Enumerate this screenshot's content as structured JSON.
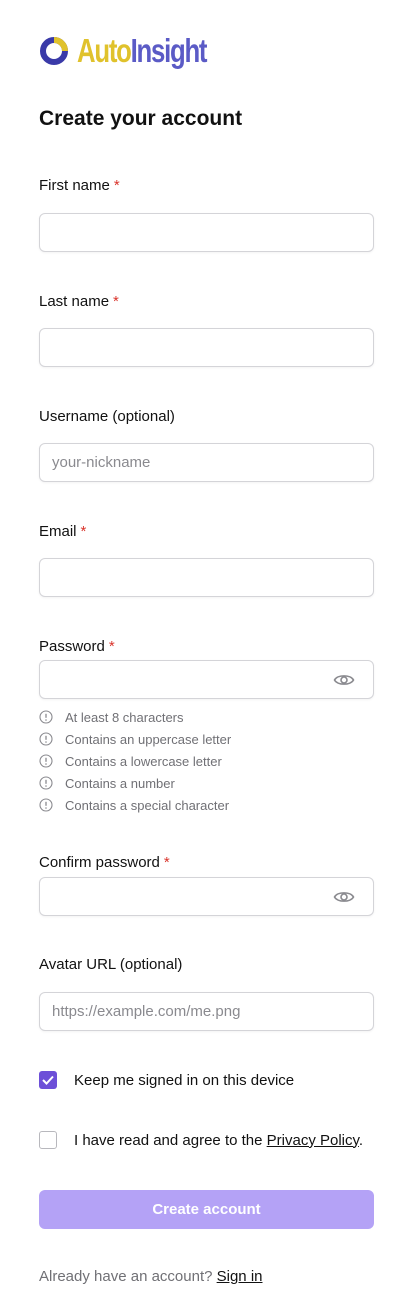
{
  "brand": {
    "name_part1": "Auto",
    "name_part2": "Insight",
    "color_primary": "#e0c22c",
    "color_secondary": "#5b5bc6"
  },
  "heading": "Create your account",
  "fields": {
    "first_name": {
      "label": "First name",
      "required_mark": "*",
      "value": "",
      "placeholder": ""
    },
    "last_name": {
      "label": "Last name",
      "required_mark": "*",
      "value": "",
      "placeholder": ""
    },
    "username": {
      "label": "Username (optional)",
      "value": "",
      "placeholder": "your-nickname"
    },
    "email": {
      "label": "Email",
      "required_mark": "*",
      "value": "",
      "placeholder": ""
    },
    "password": {
      "label": "Password",
      "required_mark": "*",
      "value": "",
      "placeholder": "",
      "toggle_icon": "eye-icon"
    },
    "confirm_password": {
      "label": "Confirm password",
      "required_mark": "*",
      "value": "",
      "placeholder": "",
      "toggle_icon": "eye-icon"
    },
    "avatar_url": {
      "label": "Avatar URL (optional)",
      "value": "",
      "placeholder": "https://example.com/me.png"
    }
  },
  "password_rules": [
    {
      "text": "At least 8 characters",
      "icon": "info-icon"
    },
    {
      "text": "Contains an uppercase letter",
      "icon": "info-icon"
    },
    {
      "text": "Contains a lowercase letter",
      "icon": "info-icon"
    },
    {
      "text": "Contains a number",
      "icon": "info-icon"
    },
    {
      "text": "Contains a special character",
      "icon": "info-icon"
    }
  ],
  "keep_signed_in": {
    "label": "Keep me signed in on this device",
    "checked": true
  },
  "privacy": {
    "prefix": "I have read and agree to the ",
    "link_text": "Privacy Policy",
    "suffix": ".",
    "checked": false
  },
  "submit_label": "Create account",
  "footer": {
    "prompt": "Already have an account?",
    "link_text": "Sign in"
  },
  "colors": {
    "accent": "#6d4fd8",
    "button_disabled": "#b4a2f6",
    "required": "#d9342b",
    "hint_text": "#707075"
  }
}
